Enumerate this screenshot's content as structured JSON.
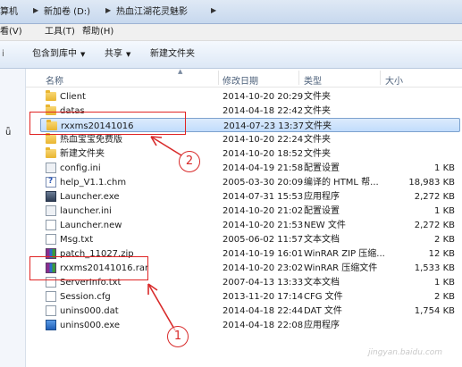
{
  "address": {
    "crumbs": [
      "算机",
      "新加卷 (D:)",
      "热血江湖花灵魅影"
    ]
  },
  "menu": {
    "items": [
      "看(V)",
      "工具(T)",
      "帮助(H)"
    ]
  },
  "toolbar": {
    "left_glyph": "i",
    "include_label": "包含到库中",
    "share_label": "共享",
    "new_folder_label": "新建文件夹"
  },
  "sidebar": {
    "glyph": "ǖ"
  },
  "columns": {
    "name": "名称",
    "date": "修改日期",
    "type": "类型",
    "size": "大小"
  },
  "files": [
    {
      "name": "Client",
      "date": "2014-10-20 20:29",
      "type": "文件夹",
      "size": "",
      "icon": "folder-icon",
      "selected": false
    },
    {
      "name": "datas",
      "date": "2014-04-18 22:42",
      "type": "文件夹",
      "size": "",
      "icon": "folder-icon",
      "selected": false
    },
    {
      "name": "rxxms20141016",
      "date": "2014-07-23 13:37",
      "type": "文件夹",
      "size": "",
      "icon": "folder-icon",
      "selected": true
    },
    {
      "name": "热血宝宝免费版",
      "date": "2014-10-20 22:24",
      "type": "文件夹",
      "size": "",
      "icon": "folder-icon",
      "selected": false
    },
    {
      "name": "新建文件夹",
      "date": "2014-10-20 18:52",
      "type": "文件夹",
      "size": "",
      "icon": "folder-icon",
      "selected": false
    },
    {
      "name": "config.ini",
      "date": "2014-04-19 21:58",
      "type": "配置设置",
      "size": "1 KB",
      "icon": "settings-file-icon",
      "selected": false
    },
    {
      "name": "help_V1.1.chm",
      "date": "2005-03-30 20:09",
      "type": "编译的 HTML 帮...",
      "size": "18,983 KB",
      "icon": "help-file-icon",
      "selected": false
    },
    {
      "name": "Launcher.exe",
      "date": "2014-07-31 15:53",
      "type": "应用程序",
      "size": "2,272 KB",
      "icon": "application-icon",
      "selected": false
    },
    {
      "name": "launcher.ini",
      "date": "2014-10-20 21:02",
      "type": "配置设置",
      "size": "1 KB",
      "icon": "settings-file-icon",
      "selected": false
    },
    {
      "name": "Launcher.new",
      "date": "2014-10-20 21:53",
      "type": "NEW 文件",
      "size": "2,272 KB",
      "icon": "document-icon",
      "selected": false
    },
    {
      "name": "Msg.txt",
      "date": "2005-06-02 11:57",
      "type": "文本文档",
      "size": "2 KB",
      "icon": "text-file-icon",
      "selected": false
    },
    {
      "name": "patch_11027.zip",
      "date": "2014-10-19 16:01",
      "type": "WinRAR ZIP 压缩...",
      "size": "12 KB",
      "icon": "winrar-archive-icon",
      "selected": false
    },
    {
      "name": "rxxms20141016.rar",
      "date": "2014-10-20 23:02",
      "type": "WinRAR 压缩文件",
      "size": "1,533 KB",
      "icon": "winrar-archive-icon",
      "selected": false
    },
    {
      "name": "ServerInfo.txt",
      "date": "2007-04-13 13:33",
      "type": "文本文档",
      "size": "1 KB",
      "icon": "text-file-icon",
      "selected": false
    },
    {
      "name": "Session.cfg",
      "date": "2013-11-20 17:14",
      "type": "CFG 文件",
      "size": "2 KB",
      "icon": "document-icon",
      "selected": false
    },
    {
      "name": "unins000.dat",
      "date": "2014-04-18 22:44",
      "type": "DAT 文件",
      "size": "1,754 KB",
      "icon": "document-icon",
      "selected": false
    },
    {
      "name": "unins000.exe",
      "date": "2014-04-18 22:08",
      "type": "应用程序",
      "size": "",
      "icon": "setup-exe-icon",
      "selected": false
    }
  ],
  "annotations": {
    "label_one": "1",
    "label_two": "2"
  },
  "watermark": "jingyan.baidu.com",
  "colors": {
    "annotation_red": "#e02424",
    "selection_blue": "#c1dcfc"
  }
}
